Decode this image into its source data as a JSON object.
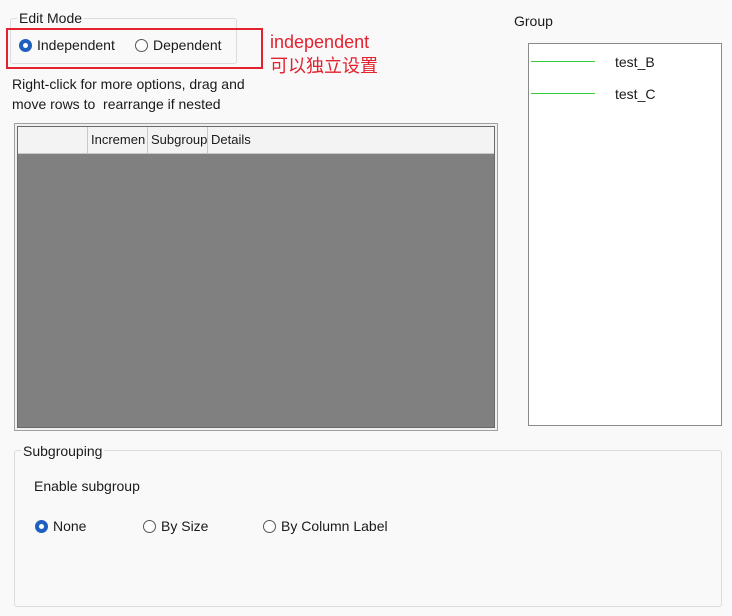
{
  "edit_mode": {
    "title": "Edit Mode",
    "options": [
      {
        "label": "Independent",
        "selected": true
      },
      {
        "label": "Dependent",
        "selected": false
      }
    ]
  },
  "annotation": {
    "line1": "independent",
    "line2": "可以独立设置",
    "color": "#e2222f"
  },
  "instructions": {
    "line1": "Right-click for more options, drag and",
    "line2": "move rows to  rearrange if nested"
  },
  "table": {
    "columns": [
      "",
      "Incremen",
      "Subgroup",
      "Details"
    ]
  },
  "group": {
    "title": "Group",
    "items": [
      {
        "label": "test_B",
        "color": "#33cc33"
      },
      {
        "label": "test_C",
        "color": "#33cc33"
      }
    ]
  },
  "subgrouping": {
    "title": "Subgrouping",
    "enable_label": "Enable subgroup",
    "options": [
      {
        "label": "None",
        "selected": true
      },
      {
        "label": "By Size",
        "selected": false
      },
      {
        "label": "By Column Label",
        "selected": false
      }
    ]
  }
}
